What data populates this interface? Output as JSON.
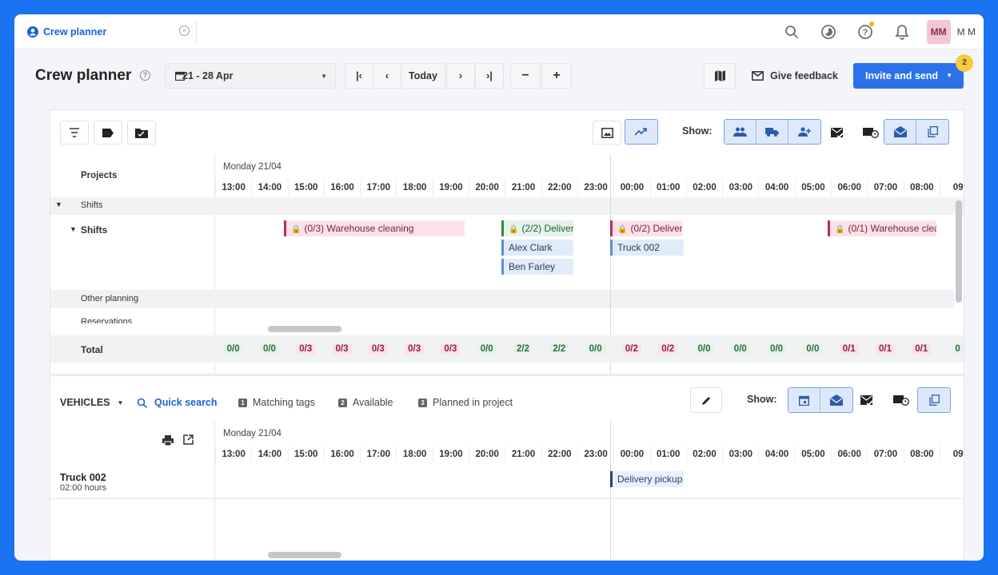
{
  "tab": {
    "title": "Crew planner"
  },
  "user": {
    "initials": "MM",
    "name": "M M"
  },
  "header": {
    "title": "Crew planner",
    "date_range": "21 - 28 Apr",
    "today": "Today",
    "feedback": "Give feedback",
    "invite": "Invite and send",
    "badge": "2"
  },
  "planner": {
    "show_label": "Show:",
    "day_label": "Monday 21/04",
    "hours": [
      "13:00",
      "14:00",
      "15:00",
      "16:00",
      "17:00",
      "18:00",
      "19:00",
      "20:00",
      "21:00",
      "22:00",
      "23:00",
      "00:00",
      "01:00",
      "02:00",
      "03:00",
      "04:00",
      "05:00",
      "06:00",
      "07:00",
      "08:00",
      "09"
    ],
    "rows": {
      "projects": "Projects",
      "shifts_group": "Shifts",
      "shifts": "Shifts",
      "other": "Other planning",
      "reservations": "Reservations",
      "total": "Total"
    },
    "bars": {
      "b1": "(0/3) Warehouse cleaning",
      "b2": "(2/2) Deliver",
      "b3": "Alex Clark",
      "b4": "Ben Farley",
      "b5": "(0/2) Deliver",
      "b6": "Truck 002",
      "b7": "(0/1) Warehouse clea"
    },
    "totals": [
      [
        "0/0",
        "g"
      ],
      [
        "0/0",
        "g"
      ],
      [
        "0/3",
        "r"
      ],
      [
        "0/3",
        "r"
      ],
      [
        "0/3",
        "r"
      ],
      [
        "0/3",
        "r"
      ],
      [
        "0/3",
        "r"
      ],
      [
        "0/0",
        "g"
      ],
      [
        "2/2",
        "g"
      ],
      [
        "2/2",
        "g"
      ],
      [
        "0/0",
        "g"
      ],
      [
        "0/2",
        "r"
      ],
      [
        "0/2",
        "r"
      ],
      [
        "0/0",
        "g"
      ],
      [
        "0/0",
        "g"
      ],
      [
        "0/0",
        "g"
      ],
      [
        "0/0",
        "g"
      ],
      [
        "0/1",
        "r"
      ],
      [
        "0/1",
        "r"
      ],
      [
        "0/1",
        "r"
      ],
      [
        "0",
        "g"
      ]
    ]
  },
  "vehicles": {
    "title": "VEHICLES",
    "quick_search": "Quick search",
    "f1": "Matching tags",
    "f2": "Available",
    "f3": "Planned in project",
    "show_label": "Show:",
    "day_label": "Monday 21/04",
    "truck": "Truck 002",
    "truck_hours": "02:00 hours",
    "bar": "Delivery pickup"
  },
  "colors": {
    "accent": "#2b72ea",
    "background": "#1a73f0"
  }
}
